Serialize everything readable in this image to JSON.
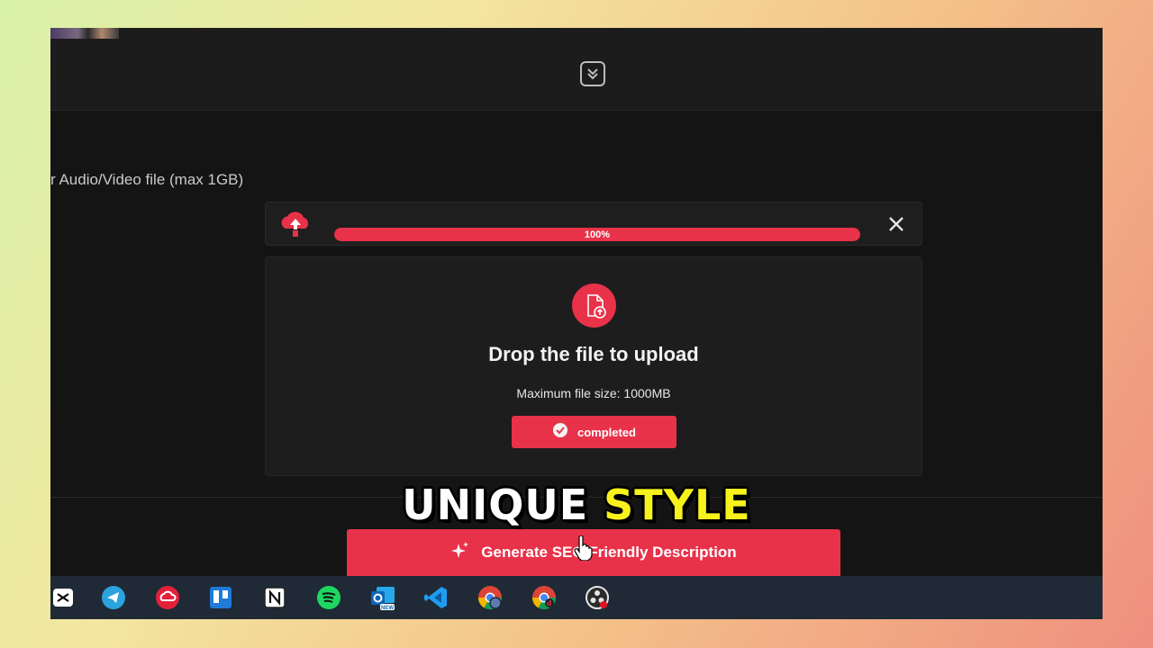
{
  "section": {
    "label": "r Audio/Video file (max 1GB)"
  },
  "upload": {
    "progress_percent": 100,
    "progress_label": "100%"
  },
  "dropzone": {
    "title": "Drop the file to upload",
    "max_size": "Maximum file size: 1000MB",
    "status_label": "completed"
  },
  "actions": {
    "generate_label": "Generate SEO Friendly Description"
  },
  "caption": {
    "word1": "UNIQUE",
    "word2": "STYLE"
  },
  "colors": {
    "accent": "#e8324a",
    "caption_highlight": "#f7f21b"
  },
  "taskbar": {
    "apps": [
      "capcut-icon",
      "telegram-icon",
      "creative-cloud-icon",
      "trello-icon",
      "notion-icon",
      "spotify-icon",
      "outlook-new-icon",
      "vscode-icon",
      "chrome-profile-icon",
      "chrome-icon",
      "obs-icon"
    ]
  }
}
